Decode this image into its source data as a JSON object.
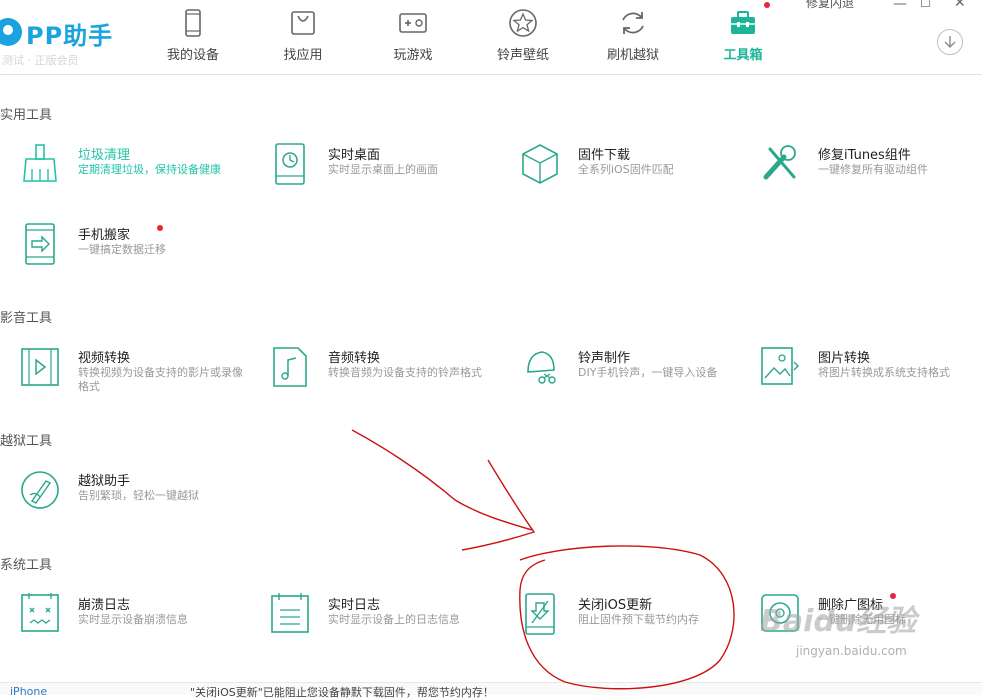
{
  "app": {
    "logo": "PP助手",
    "logo_sub": "测试 · 正版会员",
    "repair_link": "修复闪退",
    "window": {
      "minimize": "—",
      "maximize": "☐",
      "close": "✕"
    }
  },
  "nav": [
    {
      "label": "我的设备",
      "icon": "phone-icon"
    },
    {
      "label": "找应用",
      "icon": "bag-icon"
    },
    {
      "label": "玩游戏",
      "icon": "gamepad-icon"
    },
    {
      "label": "铃声壁纸",
      "icon": "star-icon"
    },
    {
      "label": "刷机越狱",
      "icon": "refresh-icon"
    },
    {
      "label": "工具箱",
      "icon": "toolbox-icon",
      "active": true
    }
  ],
  "sections": {
    "utility": "实用工具",
    "media": "影音工具",
    "jailbreak": "越狱工具",
    "system": "系统工具"
  },
  "tools": {
    "junk_clean": {
      "name": "垃圾清理",
      "desc": "定期清理垃圾，保持设备健康"
    },
    "realtime_desktop": {
      "name": "实时桌面",
      "desc": "实时显示桌面上的画面"
    },
    "firmware_download": {
      "name": "固件下载",
      "desc": "全系列iOS固件匹配"
    },
    "repair_itunes": {
      "name": "修复iTunes组件",
      "desc": "一键修复所有驱动组件"
    },
    "phone_move": {
      "name": "手机搬家",
      "desc": "一键搞定数据迁移"
    },
    "video_convert": {
      "name": "视频转换",
      "desc": "转换视频为设备支持的影片或录像格式"
    },
    "audio_convert": {
      "name": "音频转换",
      "desc": "转换音频为设备支持的铃声格式"
    },
    "ringtone_make": {
      "name": "铃声制作",
      "desc": "DIY手机铃声，一键导入设备"
    },
    "image_convert": {
      "name": "图片转换",
      "desc": "将图片转换成系统支持格式"
    },
    "jailbreak_helper": {
      "name": "越狱助手",
      "desc": "告别繁琐，轻松一键越狱"
    },
    "crash_log": {
      "name": "崩溃日志",
      "desc": "实时显示设备崩溃信息"
    },
    "realtime_log": {
      "name": "实时日志",
      "desc": "实时显示设备上的日志信息"
    },
    "close_ios_update": {
      "name": "关闭iOS更新",
      "desc": "阻止固件预下载节约内存"
    },
    "delete_icon": {
      "name": "删除广图标",
      "desc": "一键删除无用图标"
    }
  },
  "footer": {
    "device": "iPhone",
    "message": "\"关闭iOS更新\"已能阻止您设备静默下载固件，帮您节约内存！"
  },
  "watermark": {
    "text": "Baidu经验",
    "sub": "jingyan.baidu.com"
  },
  "colors": {
    "accent": "#1cb59a",
    "brand": "#1aa3de",
    "alert": "#e8263a",
    "annotation": "#cc1111"
  }
}
